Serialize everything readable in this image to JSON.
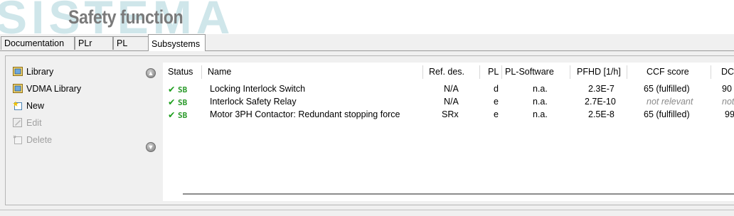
{
  "header": {
    "watermark": "SISTEMA",
    "title": "Safety function"
  },
  "tabs": [
    {
      "label": "Documentation",
      "active": false
    },
    {
      "label": "PLr",
      "active": false
    },
    {
      "label": "PL",
      "active": false
    },
    {
      "label": "Subsystems",
      "active": true
    }
  ],
  "sidebar": {
    "items": [
      {
        "label": "Library",
        "icon": "library-icon",
        "enabled": true
      },
      {
        "label": "VDMA Library",
        "icon": "vdma-library-icon",
        "enabled": true
      },
      {
        "label": "New",
        "icon": "new-icon",
        "enabled": true
      },
      {
        "label": "Edit",
        "icon": "edit-icon",
        "enabled": false
      },
      {
        "label": "Delete",
        "icon": "delete-icon",
        "enabled": false
      }
    ]
  },
  "nav": {
    "up_icon": "move-up-icon",
    "down_icon": "move-down-icon"
  },
  "table": {
    "columns": [
      "Status",
      "Name",
      "Ref. des.",
      "PL",
      "PL-Software",
      "PFHD [1/h]",
      "CCF score",
      "DC"
    ],
    "rows": [
      {
        "status": "SB",
        "name": "Locking Interlock Switch",
        "ref": "N/A",
        "pl": "d",
        "pl_sw": "n.a.",
        "pfhd": "2.3E-7",
        "ccf": "65 (fulfilled)",
        "dc": "90 ("
      },
      {
        "status": "SB",
        "name": "Interlock Safety Relay",
        "ref": "N/A",
        "pl": "e",
        "pl_sw": "n.a.",
        "pfhd": "2.7E-10",
        "ccf": "not relevant",
        "dc": "not"
      },
      {
        "status": "SB",
        "name": "Motor 3PH Contactor: Redundant stopping force",
        "ref": "SRx",
        "pl": "e",
        "pl_sw": "n.a.",
        "pfhd": "2.5E-8",
        "ccf": "65 (fulfilled)",
        "dc": "99"
      }
    ]
  },
  "colors": {
    "status_ok": "#1ea01e",
    "watermark": "#cfe6ea",
    "title": "#7a7a7a"
  }
}
